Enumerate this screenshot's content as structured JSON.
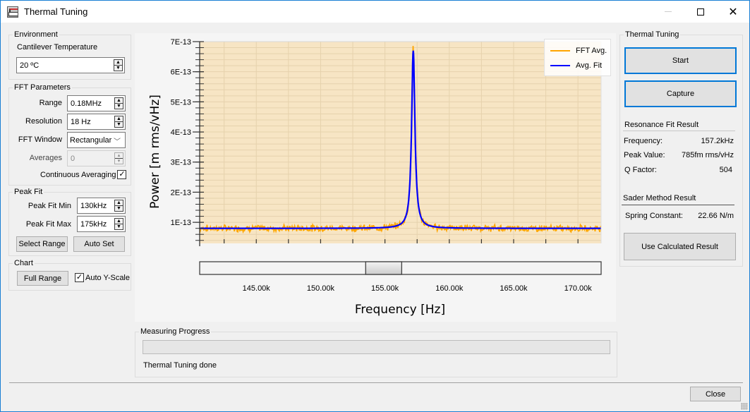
{
  "window": {
    "title": "Thermal Tuning",
    "icon": "app-logo-icon",
    "controls": [
      "minimize-icon",
      "maximize-icon",
      "close-icon"
    ]
  },
  "environment": {
    "group_label": "Environment",
    "temp_label": "Cantilever Temperature",
    "temp_value": "20 ºC"
  },
  "fft": {
    "group_label": "FFT Parameters",
    "range_label": "Range",
    "range_value": "0.18MHz",
    "resolution_label": "Resolution",
    "resolution_value": "18 Hz",
    "window_label": "FFT Window",
    "window_value": "Rectangular",
    "averages_label": "Averages",
    "averages_value": "0",
    "continuous_label": "Continuous Averaging",
    "continuous_checked": true
  },
  "peakfit": {
    "group_label": "Peak Fit",
    "min_label": "Peak Fit Min",
    "min_value": "130kHz",
    "max_label": "Peak Fit Max",
    "max_value": "175kHz",
    "select_range": "Select Range",
    "auto_set": "Auto Set"
  },
  "chart_group": {
    "group_label": "Chart",
    "full_range": "Full Range",
    "auto_y_label": "Auto Y-Scale",
    "auto_y_checked": true
  },
  "thermal": {
    "group_label": "Thermal Tuning",
    "start": "Start",
    "capture": "Capture",
    "resonance_header": "Resonance Fit Result",
    "frequency_label": "Frequency:",
    "frequency_value": "157.2kHz",
    "peak_label": "Peak Value:",
    "peak_value": "785fm rms/vHz",
    "q_label": "Q Factor:",
    "q_value": "504",
    "sader_header": "Sader Method Result",
    "spring_label": "Spring Constant:",
    "spring_value": "22.66 N/m",
    "use_result": "Use Calculated Result"
  },
  "progress": {
    "group_label": "Measuring Progress",
    "value_percent": 0,
    "status": "Thermal Tuning done"
  },
  "footer": {
    "close": "Close"
  },
  "colors": {
    "plot_bg": "#f7e5c4",
    "grid": "#e6d2ad",
    "fft": "#ffa500",
    "fit": "#0000ff",
    "accent": "#0078d7"
  },
  "chart_data": {
    "type": "line",
    "xlabel": "Frequency [Hz]",
    "ylabel": "Power [m rms/vHz]",
    "xlim": [
      140600,
      171800
    ],
    "ylim": [
      3e-14,
      7e-13
    ],
    "x_ticks": [
      145000,
      150000,
      155000,
      160000,
      165000,
      170000
    ],
    "x_tick_labels": [
      "145.00k",
      "150.00k",
      "155.00k",
      "160.00k",
      "165.00k",
      "170.00k"
    ],
    "y_ticks": [
      1e-13,
      2e-13,
      3e-13,
      4e-13,
      5e-13,
      6e-13,
      7e-13
    ],
    "y_tick_labels": [
      "1E-13",
      "2E-13",
      "3E-13",
      "4E-13",
      "5E-13",
      "6E-13",
      "7E-13"
    ],
    "grid": true,
    "legend": [
      "FFT Avg.",
      "Avg. Fit"
    ],
    "legend_position": "top-right",
    "scrollbar_thumb_range": [
      153500,
      156300
    ],
    "series": [
      {
        "name": "Avg. Fit",
        "model": "lorentzian",
        "center_hz": 157200,
        "peak": 6.7e-13,
        "baseline": 8e-14,
        "q_factor": 504
      },
      {
        "name": "FFT Avg.",
        "description": "noisy measured spectrum following fit",
        "noise_amplitude": 8e-15
      }
    ]
  }
}
